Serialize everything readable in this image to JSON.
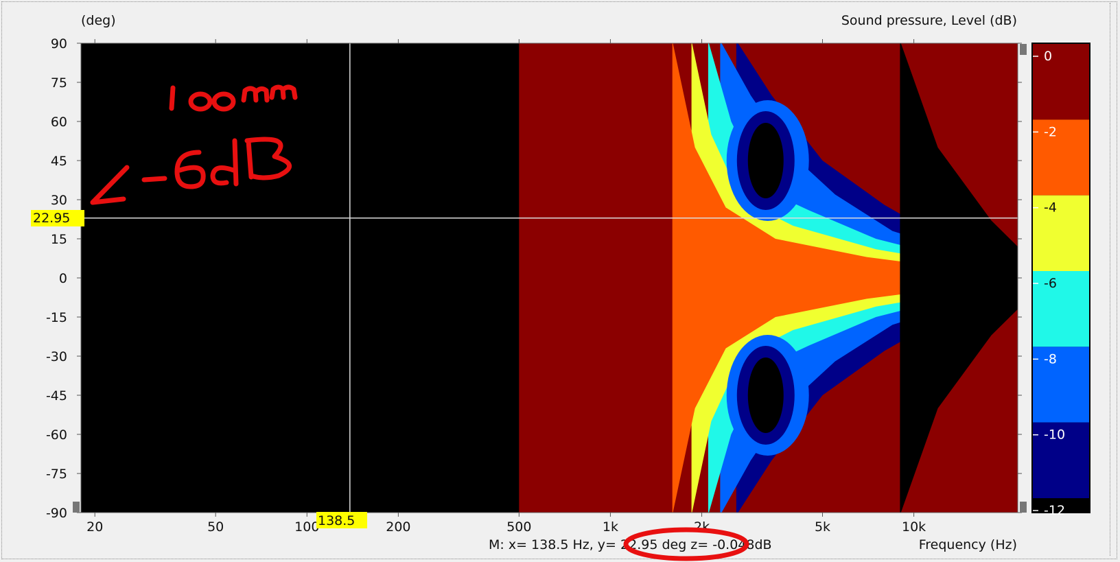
{
  "chart_data": {
    "type": "heatmap",
    "title": "Sound pressure, Level  (dB)",
    "ylabel": "(deg)",
    "xlabel": "Frequency  (Hz)",
    "x_scale": "log",
    "xlim": [
      18,
      22000
    ],
    "ylim": [
      -90,
      90
    ],
    "x_ticks": [
      {
        "value": 20,
        "label": "20"
      },
      {
        "value": 50,
        "label": "50"
      },
      {
        "value": 100,
        "label": "100"
      },
      {
        "value": 200,
        "label": "200"
      },
      {
        "value": 500,
        "label": "500"
      },
      {
        "value": 1000,
        "label": "1k"
      },
      {
        "value": 2000,
        "label": "2k"
      },
      {
        "value": 5000,
        "label": "5k"
      },
      {
        "value": 10000,
        "label": "10k"
      }
    ],
    "y_ticks": [
      90,
      75,
      60,
      45,
      30,
      15,
      0,
      -15,
      -30,
      -45,
      -60,
      -75,
      -90
    ],
    "colorbar": {
      "labels": [
        "0",
        "-2",
        "-4",
        "-6",
        "-8",
        "-10",
        "-12"
      ],
      "bands": [
        {
          "range": [
            -2,
            0
          ],
          "color": "#8b0000"
        },
        {
          "range": [
            -4,
            -2
          ],
          "color": "#ff5a00"
        },
        {
          "range": [
            -6,
            -4
          ],
          "color": "#f0ff30"
        },
        {
          "range": [
            -8,
            -6
          ],
          "color": "#20f8e8"
        },
        {
          "range": [
            -10,
            -8
          ],
          "color": "#0064ff"
        },
        {
          "range": [
            -12,
            -10
          ],
          "color": "#000088"
        }
      ],
      "below_color": "#000000"
    },
    "contour_start_hz": 500,
    "minus6dB_beam": [
      {
        "hz": 1600,
        "deg": 90
      },
      {
        "hz": 2000,
        "deg": 45
      },
      {
        "hz": 2700,
        "deg": 24
      },
      {
        "hz": 5000,
        "deg": 16
      },
      {
        "hz": 10000,
        "deg": 9
      },
      {
        "hz": 16000,
        "deg": 3
      }
    ],
    "cursor": {
      "x": 138.5,
      "y": 22.95,
      "x_label": "138.5",
      "y_label": "22.95"
    },
    "readout": "M:  x= 138.5 Hz,  y= 22.95 deg  z= -0.048dB"
  },
  "annotations": {
    "handwritten_1": "100mm",
    "handwritten_2": "-6dB"
  },
  "colors": {
    "plot_bg": "#000000",
    "cursor_highlight": "#ffff00",
    "annotation_ink": "#e81010"
  }
}
